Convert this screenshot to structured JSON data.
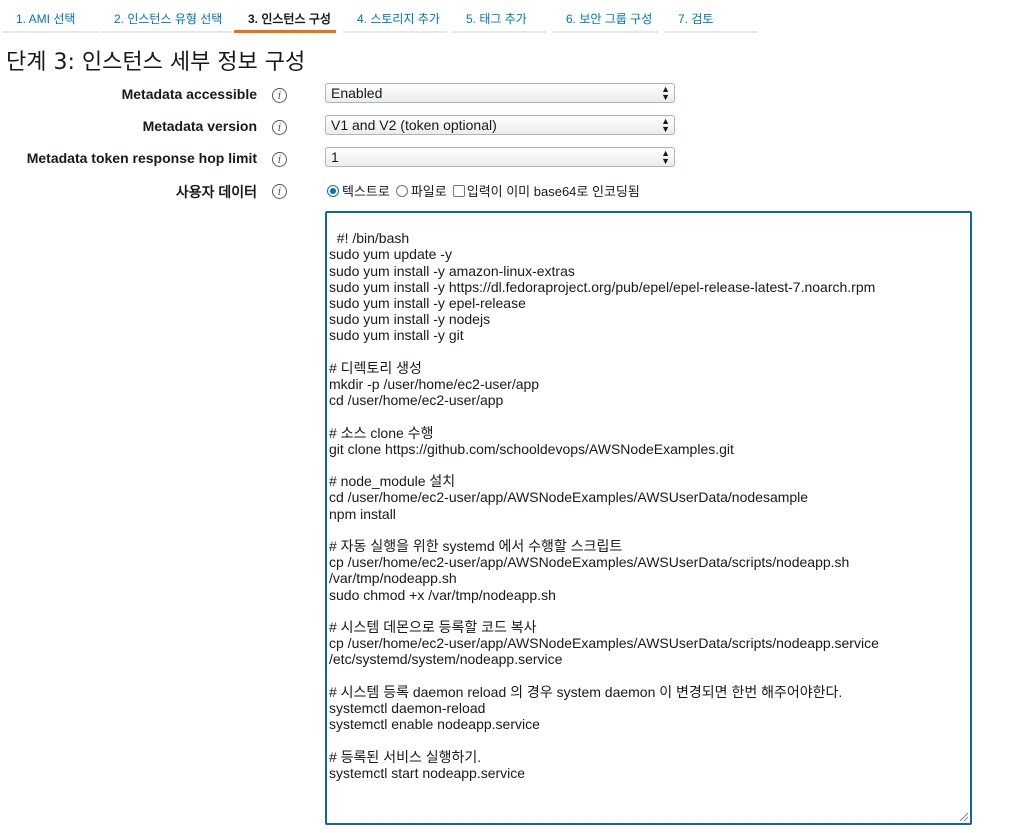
{
  "tabs": [
    {
      "label": "1. AMI 선택",
      "active": false
    },
    {
      "label": "2. 인스턴스 유형 선택",
      "active": false
    },
    {
      "label": "3. 인스턴스 구성",
      "active": true
    },
    {
      "label": "4. 스토리지 추가",
      "active": false
    },
    {
      "label": "5. 태그 추가",
      "active": false
    },
    {
      "label": "6. 보안 그룹 구성",
      "active": false
    },
    {
      "label": "7. 검토",
      "active": false
    }
  ],
  "page_title": "단계 3: 인스턴스 세부 정보 구성",
  "fields": {
    "metadata_accessible": {
      "label": "Metadata accessible",
      "value": "Enabled"
    },
    "metadata_version": {
      "label": "Metadata version",
      "value": "V1 and V2 (token optional)"
    },
    "hop_limit": {
      "label": "Metadata token response hop limit",
      "value": "1"
    },
    "user_data": {
      "label": "사용자 데이터",
      "options": {
        "text": "텍스트로",
        "file": "파일로",
        "base64": "입력이 이미 base64로 인코딩됨"
      },
      "selected": "text",
      "content": "#! /bin/bash\nsudo yum update -y\nsudo yum install -y amazon-linux-extras\nsudo yum install -y https://dl.fedoraproject.org/pub/epel/epel-release-latest-7.noarch.rpm\nsudo yum install -y epel-release\nsudo yum install -y nodejs\nsudo yum install -y git\n\n# 디렉토리 생성\nmkdir -p /user/home/ec2-user/app\ncd /user/home/ec2-user/app\n\n# 소스 clone 수행\ngit clone https://github.com/schooldevops/AWSNodeExamples.git\n\n# node_module 설치\ncd /user/home/ec2-user/app/AWSNodeExamples/AWSUserData/nodesample\nnpm install\n\n# 자동 실행을 위한 systemd 에서 수행할 스크립트\ncp /user/home/ec2-user/app/AWSNodeExamples/AWSUserData/scripts/nodeapp.sh\n/var/tmp/nodeapp.sh\nsudo chmod +x /var/tmp/nodeapp.sh\n\n# 시스템 데몬으로 등록할 코드 복사\ncp /user/home/ec2-user/app/AWSNodeExamples/AWSUserData/scripts/nodeapp.service\n/etc/systemd/system/nodeapp.service\n\n# 시스템 등록 daemon reload 의 경우 system daemon 이 변경되면 한번 해주어야한다.\nsystemctl daemon-reload\nsystemctl enable nodeapp.service\n\n# 등록된 서비스 실행하기.\nsystemctl start nodeapp.service"
    }
  },
  "colors": {
    "link": "#0073bb",
    "active_tab_underline": "#ec7211",
    "textarea_focus_border": "#1264a3"
  }
}
